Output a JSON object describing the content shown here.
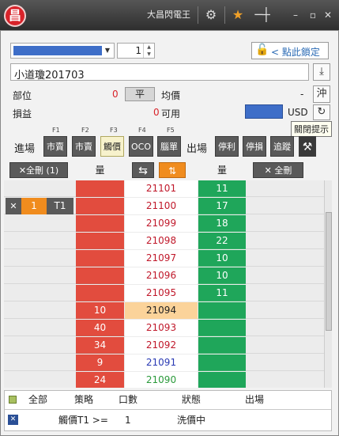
{
  "app": {
    "title": "大昌閃電王",
    "logo_text": "昌"
  },
  "toolbar": {
    "settings_icon": "gear-icon",
    "favorite_icon": "star-icon",
    "pin_icon": "pin-icon",
    "min": "–",
    "max": "▫",
    "close": "✕"
  },
  "order": {
    "account_color": "#3e6ec8",
    "quantity": "1",
    "lock_label": "< 點此鎖定",
    "product": "小道瓊201703",
    "position_label": "部位",
    "position_value": "0",
    "flat_label": "平",
    "avg_label": "均價",
    "avg_value": "-",
    "pnl_label": "損益",
    "pnl_value": "0",
    "available_label": "可用",
    "currency": "USD",
    "offset_label": "沖",
    "tooltip": "關閉提示"
  },
  "buttons": {
    "entry_label": "進場",
    "exit_label": "出場",
    "fkeys": [
      "F1",
      "F2",
      "F3",
      "F4",
      "F5"
    ],
    "entry": [
      "市賣",
      "市賣",
      "觸價",
      "OCO",
      "腦單"
    ],
    "exit": [
      "停利",
      "停損",
      "追蹤"
    ]
  },
  "ladder_header": {
    "cancel_left": "✕全刪 (1)",
    "bid_qty": "量",
    "ask_qty": "量",
    "cancel_right": "✕ 全刪"
  },
  "ladder": [
    {
      "price": "21101",
      "bid": "",
      "ask": "11",
      "color": "#c0182a"
    },
    {
      "price": "21100",
      "bid": "",
      "ask": "17",
      "color": "#c0182a",
      "order": {
        "qty": "1",
        "tag": "T1"
      }
    },
    {
      "price": "21099",
      "bid": "",
      "ask": "18",
      "color": "#c0182a"
    },
    {
      "price": "21098",
      "bid": "",
      "ask": "22",
      "color": "#c0182a"
    },
    {
      "price": "21097",
      "bid": "",
      "ask": "10",
      "color": "#c0182a"
    },
    {
      "price": "21096",
      "bid": "",
      "ask": "10",
      "color": "#c0182a"
    },
    {
      "price": "21095",
      "bid": "",
      "ask": "11",
      "color": "#c0182a"
    },
    {
      "price": "21094",
      "bid": "10",
      "ask": "",
      "color": "#222222",
      "highlight": true
    },
    {
      "price": "21093",
      "bid": "40",
      "ask": "",
      "color": "#c0182a"
    },
    {
      "price": "21092",
      "bid": "34",
      "ask": "",
      "color": "#c0182a"
    },
    {
      "price": "21091",
      "bid": "9",
      "ask": "",
      "color": "#2a3ab4"
    },
    {
      "price": "21090",
      "bid": "24",
      "ask": "",
      "color": "#2a9a3a"
    },
    {
      "price": "",
      "bid": "",
      "ask": "",
      "color": "#222222"
    }
  ],
  "grid": {
    "headers": [
      "全部",
      "策略",
      "口數",
      "狀態",
      "出場"
    ],
    "rows": [
      {
        "strategy": "觸價T1 >=",
        "qty": "1",
        "status": "洗價中",
        "exit": ""
      }
    ]
  }
}
